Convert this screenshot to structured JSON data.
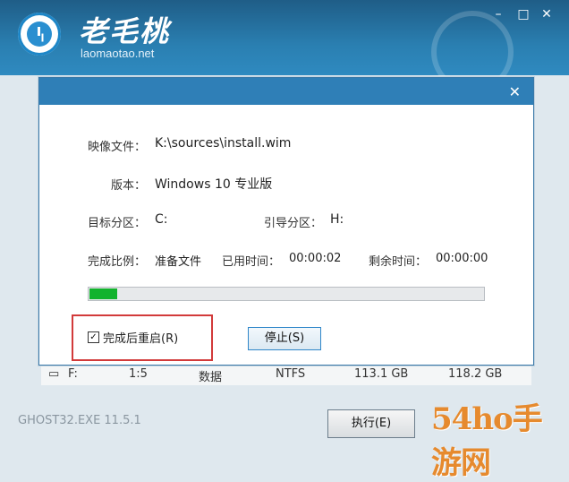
{
  "app": {
    "brand_title": "老毛桃",
    "brand_url": "laomaotao.net",
    "window_controls": {
      "minimize": "–",
      "maximize": "□",
      "close": "✕"
    }
  },
  "dialog": {
    "close_label": "✕",
    "image_file_label": "映像文件：",
    "image_file_value": "K:\\sources\\install.wim",
    "version_label": "版本：",
    "version_value": "Windows 10 专业版",
    "target_label": "目标分区：",
    "target_value": "C:",
    "boot_label": "引导分区：",
    "boot_value": "H:",
    "ratio_label": "完成比例：",
    "ratio_value": "准备文件",
    "elapsed_label": "已用时间：",
    "elapsed_value": "00:00:02",
    "remaining_label": "剩余时间：",
    "remaining_value": "00:00:00",
    "progress_fraction": 0.07,
    "checkbox_label": "完成后重启(R)",
    "checkbox_checked": true,
    "stop_label": "停止(S)"
  },
  "background_row": {
    "drive": "F:",
    "index": "1:5",
    "name": "数据",
    "fs": "NTFS",
    "free": "113.1 GB",
    "total": "118.2 GB"
  },
  "footer": {
    "version": "GHOST32.EXE 11.5.1",
    "execute_label": "执行(E)",
    "watermark_text": "54ho手游网"
  },
  "colors": {
    "titlebar": "#2a7fb1",
    "dialog_header": "#2f7fb7",
    "progress_fill": "#12b32d",
    "highlight_box": "#d23a3a"
  }
}
